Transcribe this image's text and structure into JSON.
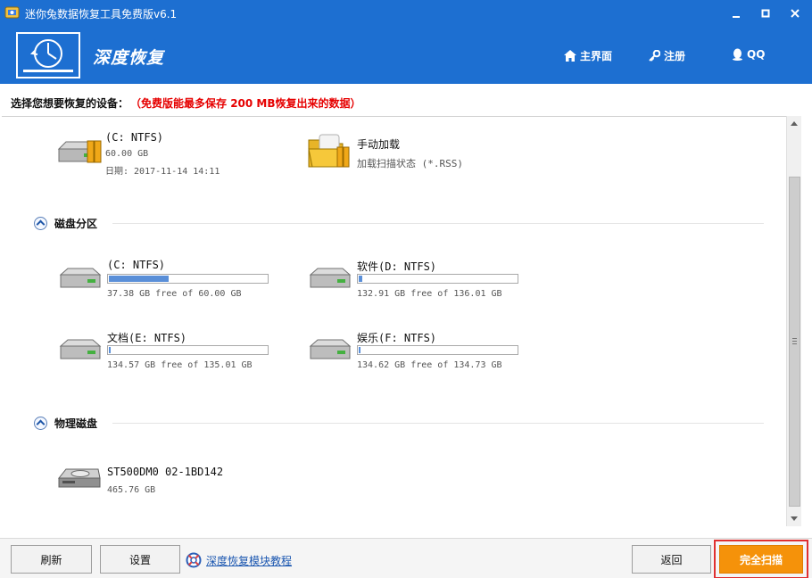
{
  "window": {
    "title": "迷你兔数据恢复工具免费版v6.1",
    "minimize": "—",
    "maximize": "□",
    "close": "✕"
  },
  "header": {
    "brand": "深度恢复",
    "nav": [
      {
        "label": "主界面",
        "icon": "home-icon"
      },
      {
        "label": "注册",
        "icon": "key-icon"
      },
      {
        "label": "QQ",
        "icon": "qq-penguin-icon"
      }
    ]
  },
  "prompt": {
    "label": "选择您想要恢复的设备：",
    "note": "（免费版能最多保存 200 MB恢复出来的数据）"
  },
  "top_items": [
    {
      "name": "(C: NTFS)",
      "size": "60.00 GB",
      "date": "日期: 2017-11-14 14:11",
      "icon": "drive-backup-icon"
    },
    {
      "name": "手动加载",
      "desc": "加载扫描状态 (*.RSS)",
      "icon": "folder-load-icon"
    }
  ],
  "partitions": {
    "title": "磁盘分区",
    "items": [
      {
        "name": "(C: NTFS)",
        "free": "37.38 GB free of 60.00 GB",
        "used_fraction": 0.377
      },
      {
        "name": "软件(D: NTFS)",
        "free": "132.91 GB free of 136.01 GB",
        "used_fraction": 0.023
      },
      {
        "name": "文档(E: NTFS)",
        "free": "134.57 GB free of 135.01 GB",
        "used_fraction": 0.003
      },
      {
        "name": "娱乐(F: NTFS)",
        "free": "134.62 GB free of 134.73 GB",
        "used_fraction": 0.001
      }
    ]
  },
  "physical": {
    "title": "物理磁盘",
    "items": [
      {
        "name": "ST500DM0 02-1BD142",
        "size": "465.76 GB"
      }
    ]
  },
  "footer": {
    "refresh": "刷新",
    "settings": "设置",
    "tutorial": "深度恢复模块教程",
    "back": "返回",
    "scan": "完全扫描"
  },
  "colors": {
    "header_blue": "#1d6fd1",
    "scan_orange": "#f5920a",
    "note_red": "#e60000",
    "bar_fill": "#5a8fd8"
  }
}
